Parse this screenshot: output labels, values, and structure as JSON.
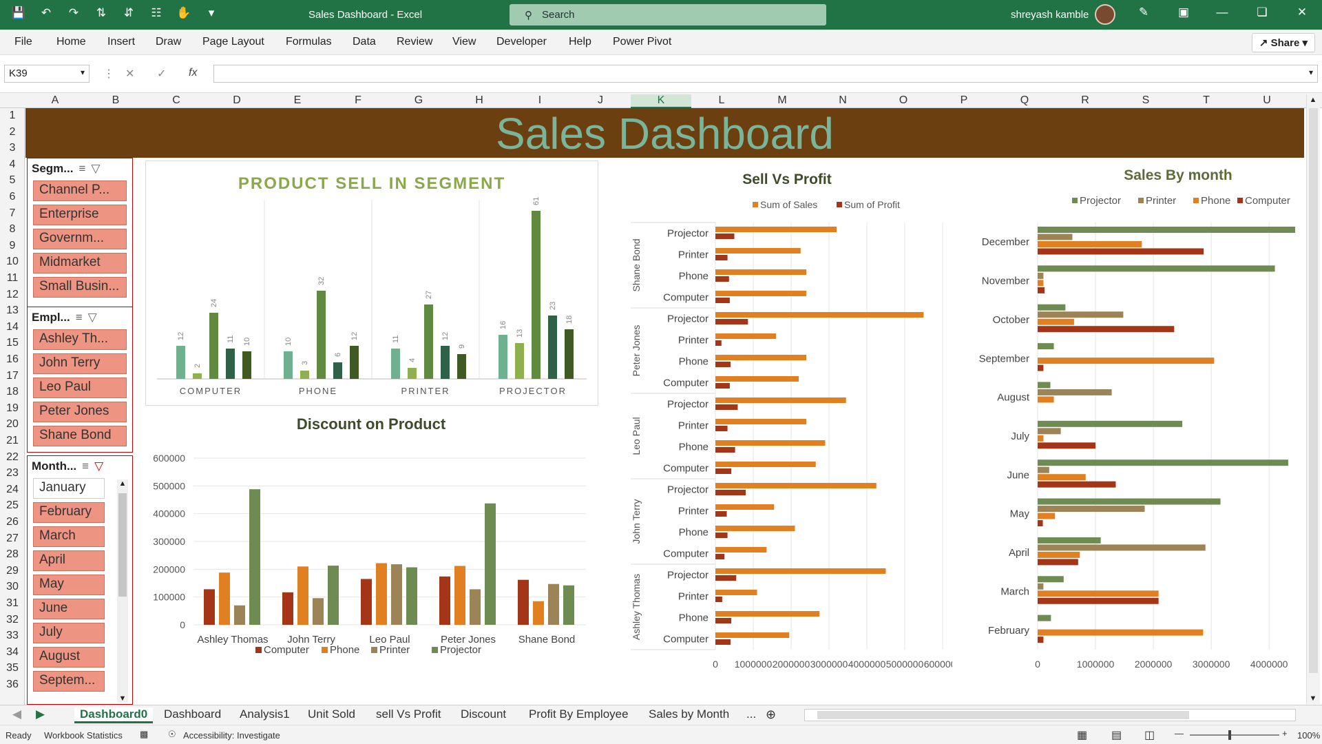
{
  "app": {
    "window_title": "Sales Dashboard  -  Excel",
    "search_placeholder": "Search",
    "user_name": "shreyash kamble"
  },
  "menu": [
    "File",
    "Home",
    "Insert",
    "Draw",
    "Page Layout",
    "Formulas",
    "Data",
    "Review",
    "View",
    "Developer",
    "Help",
    "Power Pivot"
  ],
  "share_label": "Share",
  "formula_bar": {
    "name_box": "K39",
    "formula": ""
  },
  "columns": [
    "A",
    "B",
    "C",
    "D",
    "E",
    "F",
    "G",
    "H",
    "I",
    "J",
    "K",
    "L",
    "M",
    "N",
    "O",
    "P",
    "Q",
    "R",
    "S",
    "T",
    "U"
  ],
  "selected_column": "K",
  "rows": [
    "1",
    "2",
    "3",
    "4",
    "5",
    "6",
    "7",
    "8",
    "9",
    "10",
    "11",
    "12",
    "13",
    "14",
    "15",
    "16",
    "17",
    "18",
    "19",
    "20",
    "21",
    "22",
    "23",
    "24",
    "25",
    "26",
    "27",
    "28",
    "29",
    "30",
    "31",
    "32",
    "33",
    "34",
    "35",
    "36"
  ],
  "dashboard_title": "Sales Dashboard",
  "slicers": {
    "segment": {
      "title": "Segm...",
      "items": [
        "Channel P...",
        "Enterprise",
        "Governm...",
        "Midmarket",
        "Small Busin..."
      ]
    },
    "employee": {
      "title": "Empl...",
      "items": [
        "Ashley Th...",
        "John Terry",
        "Leo Paul",
        "Peter Jones",
        "Shane Bond"
      ]
    },
    "month": {
      "title": "Month...",
      "items": [
        "January",
        "February",
        "March",
        "April",
        "May",
        "June",
        "July",
        "August",
        "Septem..."
      ],
      "unselected": [
        "January"
      ]
    }
  },
  "chart_data": [
    {
      "type": "bar",
      "title": "PRODUCT SELL IN SEGMENT",
      "categories": [
        "COMPUTER",
        "PHONE",
        "PRINTER",
        "PROJECTOR"
      ],
      "series": [
        {
          "values": [
            12,
            10,
            11,
            16
          ],
          "color": "#6fb08f"
        },
        {
          "values": [
            2,
            3,
            4,
            13
          ],
          "color": "#8fb04f"
        },
        {
          "values": [
            24,
            32,
            27,
            61
          ],
          "color": "#5f8a3f"
        },
        {
          "values": [
            11,
            6,
            12,
            23
          ],
          "color": "#2f6048"
        },
        {
          "values": [
            10,
            12,
            9,
            18
          ],
          "color": "#3f5a22"
        }
      ],
      "ylim": [
        0,
        65
      ]
    },
    {
      "type": "bar",
      "title": "Discount on Product",
      "categories": [
        "Ashley Thomas",
        "John Terry",
        "Leo Paul",
        "Peter Jones",
        "Shane Bond"
      ],
      "series": [
        {
          "name": "Computer",
          "color": "#a43517",
          "values": [
            128000,
            117000,
            165000,
            174000,
            162000
          ]
        },
        {
          "name": "Phone",
          "color": "#e08020",
          "values": [
            188000,
            210000,
            222000,
            212000,
            85000
          ]
        },
        {
          "name": "Printer",
          "color": "#9c8456",
          "values": [
            70000,
            96000,
            218000,
            128000,
            147000
          ]
        },
        {
          "name": "Projector",
          "color": "#6e8b52",
          "values": [
            488000,
            213000,
            207000,
            437000,
            142000
          ]
        }
      ],
      "yticks": [
        "0",
        "100000",
        "200000",
        "300000",
        "400000",
        "500000",
        "600000"
      ],
      "ylim": [
        0,
        600000
      ]
    },
    {
      "type": "bar",
      "orientation": "horizontal",
      "title": "Sell Vs Profit",
      "groups": [
        "Shane Bond",
        "Peter Jones",
        "Leo Paul",
        "John Terry",
        "Ashley Thomas"
      ],
      "categories": [
        "Projector",
        "Printer",
        "Phone",
        "Computer"
      ],
      "series": [
        {
          "name": "Sum of  Sales",
          "color": "#e08020",
          "values": [
            [
              3200000,
              2250000,
              2400000,
              2400000
            ],
            [
              5500000,
              1600000,
              2400000,
              2200000
            ],
            [
              3450000,
              2400000,
              2900000,
              2650000
            ],
            [
              4250000,
              1550000,
              2100000,
              1350000
            ],
            [
              4500000,
              1100000,
              2750000,
              1950000
            ]
          ]
        },
        {
          "name": "Sum of Profit",
          "color": "#a43517",
          "values": [
            [
              500000,
              320000,
              360000,
              380000
            ],
            [
              860000,
              160000,
              400000,
              380000
            ],
            [
              590000,
              320000,
              520000,
              420000
            ],
            [
              800000,
              300000,
              320000,
              240000
            ],
            [
              550000,
              180000,
              420000,
              400000
            ]
          ]
        }
      ],
      "xticks": [
        "0",
        "1000000",
        "2000000",
        "3000000",
        "4000000",
        "5000000",
        "6000000"
      ],
      "xlim": [
        0,
        6000000
      ]
    },
    {
      "type": "bar",
      "orientation": "horizontal",
      "title": "Sales By month",
      "categories": [
        "December",
        "November",
        "October",
        "September",
        "August",
        "July",
        "June",
        "May",
        "April",
        "March",
        "February"
      ],
      "series": [
        {
          "name": "Projector",
          "color": "#6e8b52",
          "values": [
            4450000,
            4100000,
            480000,
            280000,
            220000,
            2500000,
            4330000,
            3160000,
            1090000,
            450000,
            230000
          ]
        },
        {
          "name": "Printer",
          "color": "#9c8456",
          "values": [
            600000,
            100000,
            1480000,
            0,
            1280000,
            400000,
            200000,
            1850000,
            2900000,
            100000,
            0
          ]
        },
        {
          "name": "Phone",
          "color": "#e08020",
          "values": [
            1800000,
            100000,
            630000,
            3050000,
            280000,
            100000,
            830000,
            300000,
            730000,
            2090000,
            2860000
          ]
        },
        {
          "name": "Computer",
          "color": "#a43517",
          "values": [
            2870000,
            120000,
            2360000,
            100000,
            0,
            1000000,
            1350000,
            90000,
            700000,
            2090000,
            100000
          ]
        }
      ],
      "xticks": [
        "0",
        "1000000",
        "2000000",
        "3000000",
        "4000000"
      ],
      "xlim": [
        0,
        4450000
      ]
    }
  ],
  "sheet_tabs": [
    "Dashboard0",
    "Dashboard",
    "Analysis1",
    "Unit Sold",
    "sell Vs Profit",
    "Discount",
    "Profit By Employee",
    "Sales by Month",
    "..."
  ],
  "active_tab": "Dashboard0",
  "status": {
    "ready": "Ready",
    "workbook_stats": "Workbook Statistics",
    "accessibility": "Accessibility: Investigate",
    "zoom": "100%"
  }
}
